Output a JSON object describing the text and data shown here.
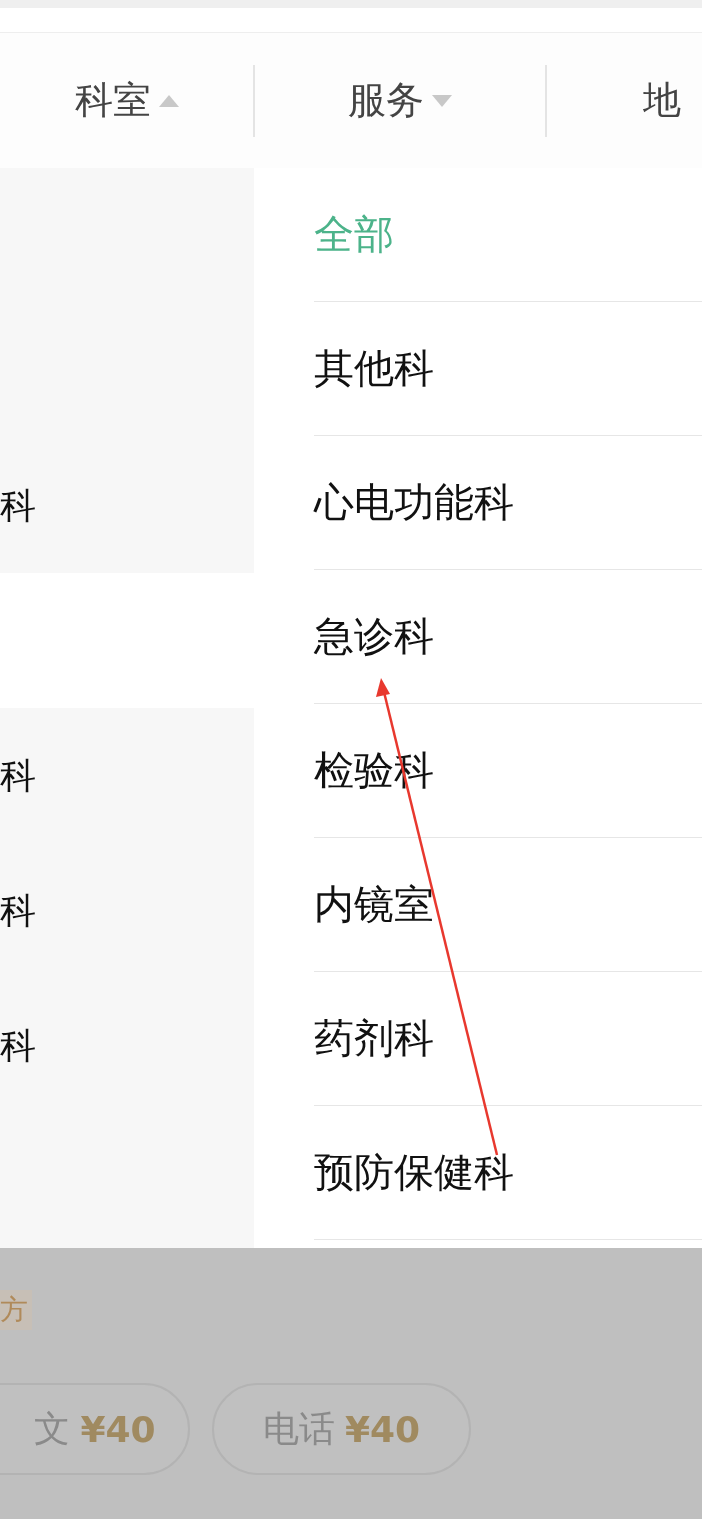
{
  "filter_tabs": [
    {
      "label": "科室",
      "expanded": true
    },
    {
      "label": "服务",
      "expanded": false
    },
    {
      "label": "地"
    }
  ],
  "category_panels": [
    {
      "rows": [
        {},
        {},
        {
          "label": "科"
        }
      ]
    },
    {
      "rows": [
        {
          "label": "科"
        },
        {
          "label": "科"
        },
        {
          "label": "科"
        },
        {}
      ]
    }
  ],
  "departments": [
    {
      "label": "全部",
      "selected": true
    },
    {
      "label": "其他科",
      "selected": false
    },
    {
      "label": "心电功能科",
      "selected": false
    },
    {
      "label": "急诊科",
      "selected": false
    },
    {
      "label": "检验科",
      "selected": false
    },
    {
      "label": "内镜室",
      "selected": false
    },
    {
      "label": "药剂科",
      "selected": false
    },
    {
      "label": "预防保健科",
      "selected": false
    }
  ],
  "background_card": {
    "tag": "方",
    "consult_buttons": [
      {
        "label": "文",
        "price": "¥40"
      },
      {
        "label": "电话",
        "price": "¥40"
      }
    ]
  }
}
